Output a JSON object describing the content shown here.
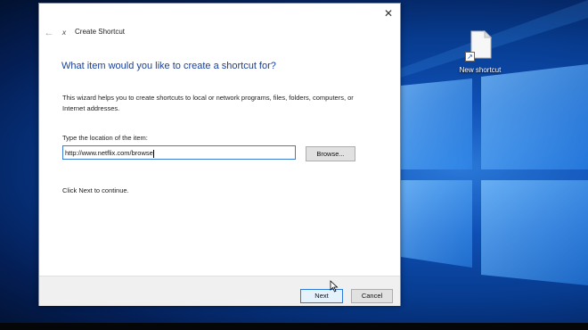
{
  "desktop": {
    "icon_label": "New shortcut",
    "icon_name": "file-icon",
    "shortcut_arrow": "↗"
  },
  "dialog": {
    "title": "Create Shortcut",
    "close_glyph": "✕",
    "back_glyph": "←",
    "app_glyph": "𝘹",
    "heading": "What item would you like to create a shortcut for?",
    "description": "This wizard helps you to create shortcuts to local or network programs, files, folders, computers, or Internet addresses.",
    "location_label": "Type the location of the item:",
    "location_value": "http://www.netflix.com/browse",
    "browse_label": "Browse...",
    "continue_text": "Click Next to continue.",
    "next_label": "Next",
    "cancel_label": "Cancel"
  },
  "colors": {
    "heading": "#1a3f98",
    "accent": "#2c7ad6",
    "desktop_blue": "#0e4fb5"
  }
}
